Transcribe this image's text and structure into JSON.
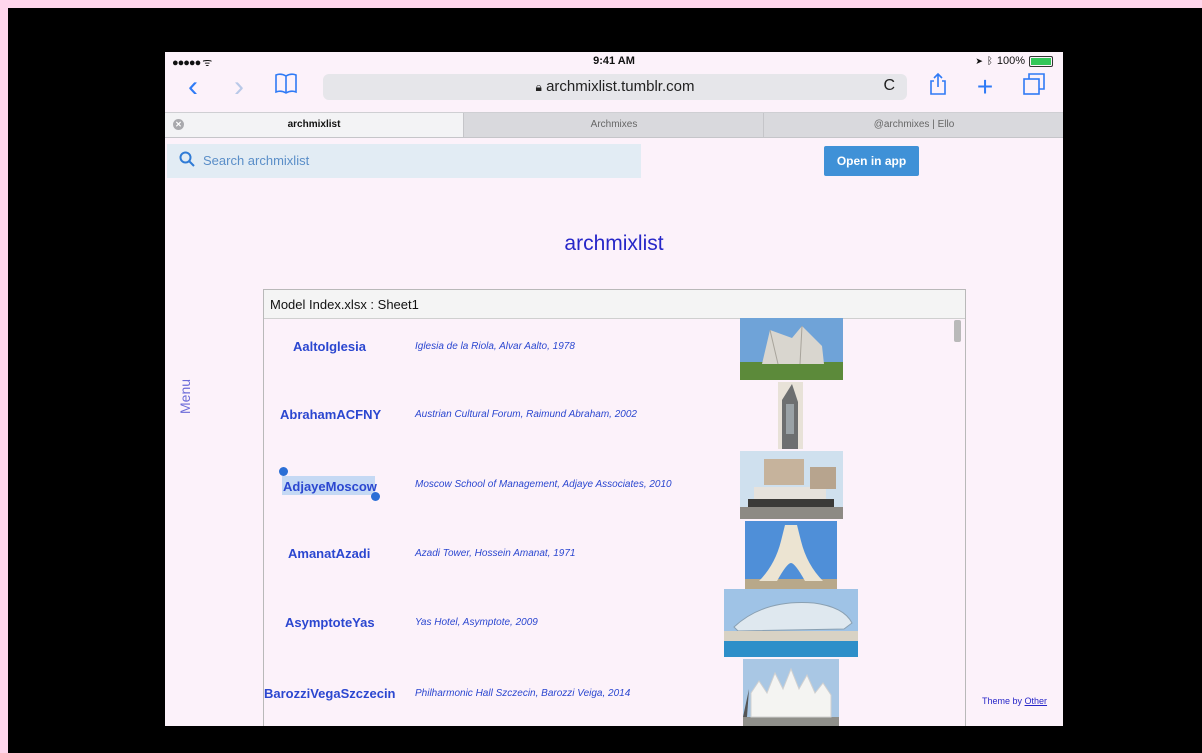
{
  "status_bar": {
    "signal": "●●●●● ᯤ",
    "time": "9:41 AM",
    "battery": "100%"
  },
  "toolbar": {
    "back_icon": "‹",
    "forward_icon": "›",
    "url": "archmixlist.tumblr.com",
    "reload_icon": "C"
  },
  "tabs": [
    {
      "label": "archmixlist"
    },
    {
      "label": "Archmixes"
    },
    {
      "label": "@archmixes | Ello"
    }
  ],
  "search": {
    "placeholder": "Search archmixlist"
  },
  "open_app_label": "Open in app",
  "site_title": "archmixlist",
  "menu_label": "Menu",
  "sheet_title": "Model Index.xlsx : Sheet1",
  "rows": [
    {
      "name": "AaltoIglesia",
      "desc": "Iglesia de la Riola, Alvar Aalto, 1978"
    },
    {
      "name": "AbrahamACFNY",
      "desc": "Austrian Cultural Forum, Raimund Abraham, 2002"
    },
    {
      "name": "AdjayeMoscow",
      "desc": "Moscow School of Management, Adjaye Associates, 2010"
    },
    {
      "name": "AmanatAzadi",
      "desc": "Azadi Tower, Hossein Amanat, 1971"
    },
    {
      "name": "AsymptoteYas",
      "desc": "Yas Hotel, Asymptote, 2009"
    },
    {
      "name": "BarozziVegaSzczecin",
      "desc": "Philharmonic Hall Szczecin, Barozzi Veiga, 2014"
    }
  ],
  "theme": {
    "prefix": "Theme by ",
    "link": "Other"
  }
}
